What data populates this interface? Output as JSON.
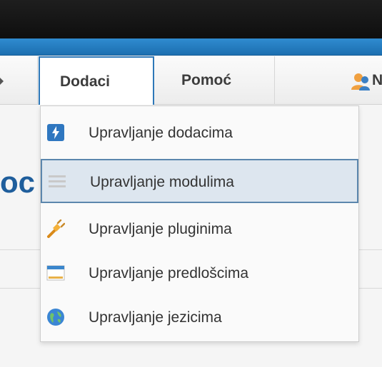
{
  "menubar": {
    "items": [
      {
        "label": "Dodaci",
        "active": true
      },
      {
        "label": "Pomoć",
        "active": false
      },
      {
        "label": "N",
        "active": false
      }
    ]
  },
  "page": {
    "title_fragment": "oc"
  },
  "dropdown": {
    "items": [
      {
        "label": "Upravljanje dodacima",
        "icon": "extensions-icon",
        "selected": false
      },
      {
        "label": "Upravljanje modulima",
        "icon": "modules-icon",
        "selected": true
      },
      {
        "label": "Upravljanje pluginima",
        "icon": "plugin-icon",
        "selected": false
      },
      {
        "label": "Upravljanje predlošcima",
        "icon": "template-icon",
        "selected": false
      },
      {
        "label": "Upravljanje jezicima",
        "icon": "globe-icon",
        "selected": false
      }
    ]
  },
  "colors": {
    "accent": "#2e78b8",
    "title": "#1f5e9c",
    "selected_bg": "#dde6ef"
  }
}
